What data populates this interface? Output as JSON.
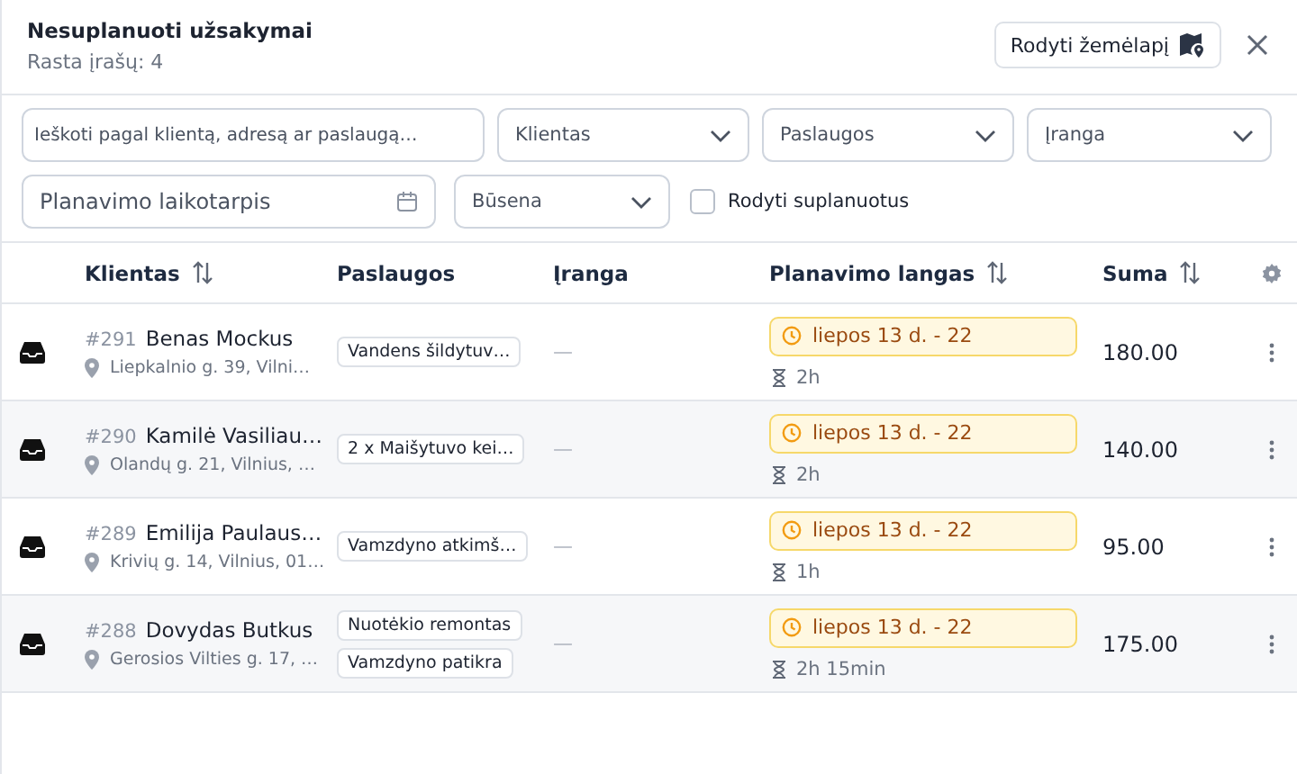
{
  "header": {
    "title": "Nesuplanuoti užsakymai",
    "subtitle": "Rasta įrašų: 4",
    "map_button": "Rodyti žemėlapį"
  },
  "filters": {
    "search": {
      "placeholder": "Ieškoti pagal klientą, adresą ar paslaugą…"
    },
    "dropdowns": [
      {
        "placeholder": "Klientas"
      },
      {
        "placeholder": "Paslaugos"
      },
      {
        "placeholder": "Įranga"
      }
    ],
    "period": {
      "placeholder": "Planavimo laikotarpis"
    },
    "status": {
      "placeholder": "Būsena"
    },
    "show_planned": {
      "label": "Rodyti suplanuotus",
      "checked": false
    }
  },
  "table": {
    "columns": [
      {
        "label": "Klientas",
        "sortable": true
      },
      {
        "label": "Paslaugos",
        "sortable": false
      },
      {
        "label": "Įranga",
        "sortable": false
      },
      {
        "label": "Planavimo langas",
        "sortable": true
      },
      {
        "label": "Suma",
        "sortable": true
      }
    ],
    "rows": [
      {
        "number": "#291",
        "client": "Benas Mockus",
        "address": "Liepkalnio g. 39, Vilni…",
        "services": [
          "Vandens šildytuv…"
        ],
        "equipment": "—",
        "window": "liepos 13 d. - 22",
        "duration": "2h",
        "sum": "180.00"
      },
      {
        "number": "#290",
        "client": "Kamilė Vasiliau…",
        "address": "Olandų g. 21, Vilnius, …",
        "services": [
          "2 x Maišytuvo kei…"
        ],
        "equipment": "—",
        "window": "liepos 13 d. - 22",
        "duration": "2h",
        "sum": "140.00"
      },
      {
        "number": "#289",
        "client": "Emilija Paulaus…",
        "address": "Krivių g. 14, Vilnius, 01…",
        "services": [
          "Vamzdyno atkimš…"
        ],
        "equipment": "—",
        "window": "liepos 13 d. - 22",
        "duration": "1h",
        "sum": "95.00"
      },
      {
        "number": "#288",
        "client": "Dovydas Butkus",
        "address": "Gerosios Vilties g. 17, …",
        "services": [
          "Nuotėkio remontas",
          "Vamzdyno patikra"
        ],
        "equipment": "—",
        "window": "liepos 13 d. - 22",
        "duration": "2h 15min",
        "sum": "175.00"
      }
    ]
  }
}
